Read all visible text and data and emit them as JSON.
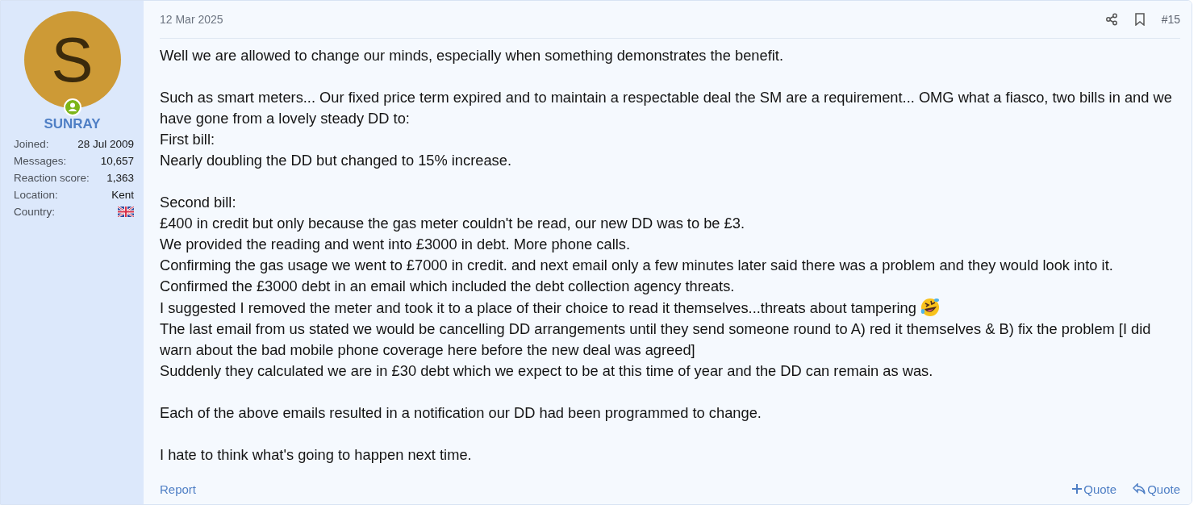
{
  "author": {
    "initial": "S",
    "name": "SUNRAY",
    "online": true,
    "stats": [
      {
        "label": "Joined:",
        "value": "28 Jul 2009",
        "kind": "text"
      },
      {
        "label": "Messages:",
        "value": "10,657",
        "kind": "text"
      },
      {
        "label": "Reaction score:",
        "value": "1,363",
        "kind": "text"
      },
      {
        "label": "Location:",
        "value": "Kent",
        "kind": "text"
      },
      {
        "label": "Country:",
        "kind": "flag"
      }
    ]
  },
  "post": {
    "date": "12 Mar 2025",
    "number": "#15",
    "paragraphs": [
      [
        {
          "text": "Well we are allowed to change our minds, especially when something demonstrates the benefit.",
          "kind": "line"
        }
      ],
      [
        {
          "text": "Such as smart meters... Our fixed price term expired and to maintain a respectable deal the SM are a requirement... OMG what a fiasco, two bills in and we have gone from a lovely steady DD to:",
          "kind": "line"
        },
        {
          "text": "First bill:",
          "kind": "line"
        },
        {
          "text": "Nearly doubling the DD but changed to 15% increase.",
          "kind": "line"
        }
      ],
      [
        {
          "text": "Second bill:",
          "kind": "line"
        },
        {
          "text": "£400 in credit but only because the gas meter couldn't be read, our new DD was to be £3.",
          "kind": "line"
        },
        {
          "text": "We provided the reading and went into £3000 in debt. More phone calls.",
          "kind": "line"
        },
        {
          "text": "Confirming the gas usage we went to £7000 in credit. and next email only a few minutes later said there was a problem and they would look into it.",
          "kind": "line"
        },
        {
          "text": "Confirmed the £3000 debt in an email which included the debt collection agency threats.",
          "kind": "line"
        },
        {
          "text": "I suggested I removed the meter and took it to a place of their choice to read it themselves...threats about tampering",
          "kind": "emoji"
        },
        {
          "text": "The last email from us stated we would be cancelling DD arrangements until they send someone round to A) red it themselves & B) fix the problem [I did warn about the bad mobile phone coverage here before the new deal was agreed]",
          "kind": "line"
        },
        {
          "text": "Suddenly they calculated we are in £30 debt which we expect to be at this time of year and the DD can remain as was.",
          "kind": "line"
        }
      ],
      [
        {
          "text": "Each of the above emails resulted in a notification our DD had been programmed to change.",
          "kind": "line"
        }
      ],
      [
        {
          "text": "I hate to think what's going to happen next time.",
          "kind": "line"
        }
      ]
    ],
    "footer": {
      "report": "Report",
      "actions": [
        {
          "label": "Quote",
          "kind": "multi"
        },
        {
          "label": "Quote",
          "kind": "reply"
        }
      ]
    }
  }
}
